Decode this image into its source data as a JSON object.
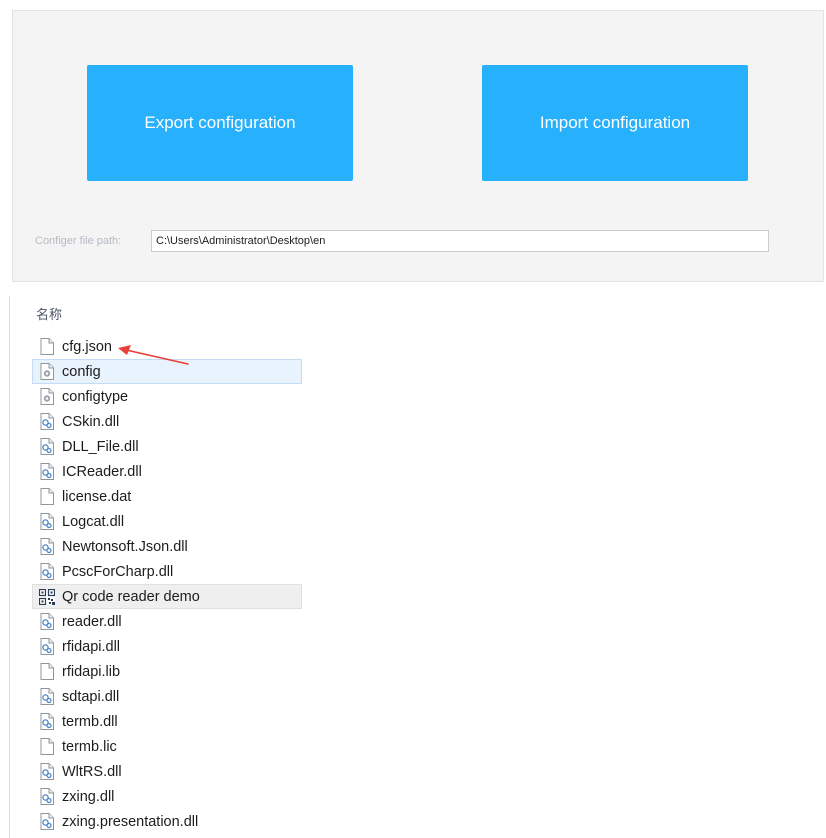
{
  "config": {
    "export_label": "Export configuration",
    "import_label": "Import configuration",
    "path_label": "Configer file path:",
    "path_value": "C:\\Users\\Administrator\\Desktop\\en"
  },
  "explorer": {
    "column_header": "名称",
    "files": [
      {
        "name": "cfg.json",
        "icon": "blank-file-icon"
      },
      {
        "name": "config",
        "icon": "settings-file-icon"
      },
      {
        "name": "configtype",
        "icon": "settings-file-icon"
      },
      {
        "name": "CSkin.dll",
        "icon": "dll-file-icon"
      },
      {
        "name": "DLL_File.dll",
        "icon": "dll-file-icon"
      },
      {
        "name": "ICReader.dll",
        "icon": "dll-file-icon"
      },
      {
        "name": "license.dat",
        "icon": "blank-file-icon"
      },
      {
        "name": "Logcat.dll",
        "icon": "dll-file-icon"
      },
      {
        "name": "Newtonsoft.Json.dll",
        "icon": "dll-file-icon"
      },
      {
        "name": "PcscForCharp.dll",
        "icon": "dll-file-icon"
      },
      {
        "name": "Qr code reader demo",
        "icon": "qr-code-icon"
      },
      {
        "name": "reader.dll",
        "icon": "dll-file-icon"
      },
      {
        "name": "rfidapi.dll",
        "icon": "dll-file-icon"
      },
      {
        "name": "rfidapi.lib",
        "icon": "blank-file-icon"
      },
      {
        "name": "sdtapi.dll",
        "icon": "dll-file-icon"
      },
      {
        "name": "termb.dll",
        "icon": "dll-file-icon"
      },
      {
        "name": "termb.lic",
        "icon": "blank-file-icon"
      },
      {
        "name": "WltRS.dll",
        "icon": "dll-file-icon"
      },
      {
        "name": "zxing.dll",
        "icon": "dll-file-icon"
      },
      {
        "name": "zxing.presentation.dll",
        "icon": "dll-file-icon"
      }
    ]
  },
  "colors": {
    "button_bg": "#27b0fc",
    "panel_bg": "#f4f4f5",
    "annotation_arrow": "#e8403a"
  }
}
